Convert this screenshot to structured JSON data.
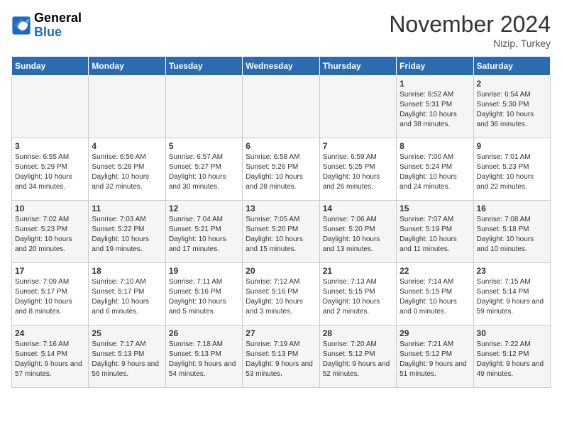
{
  "logo": {
    "line1": "General",
    "line2": "Blue"
  },
  "header": {
    "month": "November 2024",
    "location": "Nizip, Turkey"
  },
  "weekdays": [
    "Sunday",
    "Monday",
    "Tuesday",
    "Wednesday",
    "Thursday",
    "Friday",
    "Saturday"
  ],
  "weeks": [
    [
      {
        "day": "",
        "info": ""
      },
      {
        "day": "",
        "info": ""
      },
      {
        "day": "",
        "info": ""
      },
      {
        "day": "",
        "info": ""
      },
      {
        "day": "",
        "info": ""
      },
      {
        "day": "1",
        "info": "Sunrise: 6:52 AM\nSunset: 5:31 PM\nDaylight: 10 hours and 38 minutes."
      },
      {
        "day": "2",
        "info": "Sunrise: 6:54 AM\nSunset: 5:30 PM\nDaylight: 10 hours and 36 minutes."
      }
    ],
    [
      {
        "day": "3",
        "info": "Sunrise: 6:55 AM\nSunset: 5:29 PM\nDaylight: 10 hours and 34 minutes."
      },
      {
        "day": "4",
        "info": "Sunrise: 6:56 AM\nSunset: 5:28 PM\nDaylight: 10 hours and 32 minutes."
      },
      {
        "day": "5",
        "info": "Sunrise: 6:57 AM\nSunset: 5:27 PM\nDaylight: 10 hours and 30 minutes."
      },
      {
        "day": "6",
        "info": "Sunrise: 6:58 AM\nSunset: 5:26 PM\nDaylight: 10 hours and 28 minutes."
      },
      {
        "day": "7",
        "info": "Sunrise: 6:59 AM\nSunset: 5:25 PM\nDaylight: 10 hours and 26 minutes."
      },
      {
        "day": "8",
        "info": "Sunrise: 7:00 AM\nSunset: 5:24 PM\nDaylight: 10 hours and 24 minutes."
      },
      {
        "day": "9",
        "info": "Sunrise: 7:01 AM\nSunset: 5:23 PM\nDaylight: 10 hours and 22 minutes."
      }
    ],
    [
      {
        "day": "10",
        "info": "Sunrise: 7:02 AM\nSunset: 5:23 PM\nDaylight: 10 hours and 20 minutes."
      },
      {
        "day": "11",
        "info": "Sunrise: 7:03 AM\nSunset: 5:22 PM\nDaylight: 10 hours and 19 minutes."
      },
      {
        "day": "12",
        "info": "Sunrise: 7:04 AM\nSunset: 5:21 PM\nDaylight: 10 hours and 17 minutes."
      },
      {
        "day": "13",
        "info": "Sunrise: 7:05 AM\nSunset: 5:20 PM\nDaylight: 10 hours and 15 minutes."
      },
      {
        "day": "14",
        "info": "Sunrise: 7:06 AM\nSunset: 5:20 PM\nDaylight: 10 hours and 13 minutes."
      },
      {
        "day": "15",
        "info": "Sunrise: 7:07 AM\nSunset: 5:19 PM\nDaylight: 10 hours and 11 minutes."
      },
      {
        "day": "16",
        "info": "Sunrise: 7:08 AM\nSunset: 5:18 PM\nDaylight: 10 hours and 10 minutes."
      }
    ],
    [
      {
        "day": "17",
        "info": "Sunrise: 7:09 AM\nSunset: 5:17 PM\nDaylight: 10 hours and 8 minutes."
      },
      {
        "day": "18",
        "info": "Sunrise: 7:10 AM\nSunset: 5:17 PM\nDaylight: 10 hours and 6 minutes."
      },
      {
        "day": "19",
        "info": "Sunrise: 7:11 AM\nSunset: 5:16 PM\nDaylight: 10 hours and 5 minutes."
      },
      {
        "day": "20",
        "info": "Sunrise: 7:12 AM\nSunset: 5:16 PM\nDaylight: 10 hours and 3 minutes."
      },
      {
        "day": "21",
        "info": "Sunrise: 7:13 AM\nSunset: 5:15 PM\nDaylight: 10 hours and 2 minutes."
      },
      {
        "day": "22",
        "info": "Sunrise: 7:14 AM\nSunset: 5:15 PM\nDaylight: 10 hours and 0 minutes."
      },
      {
        "day": "23",
        "info": "Sunrise: 7:15 AM\nSunset: 5:14 PM\nDaylight: 9 hours and 59 minutes."
      }
    ],
    [
      {
        "day": "24",
        "info": "Sunrise: 7:16 AM\nSunset: 5:14 PM\nDaylight: 9 hours and 57 minutes."
      },
      {
        "day": "25",
        "info": "Sunrise: 7:17 AM\nSunset: 5:13 PM\nDaylight: 9 hours and 56 minutes."
      },
      {
        "day": "26",
        "info": "Sunrise: 7:18 AM\nSunset: 5:13 PM\nDaylight: 9 hours and 54 minutes."
      },
      {
        "day": "27",
        "info": "Sunrise: 7:19 AM\nSunset: 5:13 PM\nDaylight: 9 hours and 53 minutes."
      },
      {
        "day": "28",
        "info": "Sunrise: 7:20 AM\nSunset: 5:12 PM\nDaylight: 9 hours and 52 minutes."
      },
      {
        "day": "29",
        "info": "Sunrise: 7:21 AM\nSunset: 5:12 PM\nDaylight: 9 hours and 51 minutes."
      },
      {
        "day": "30",
        "info": "Sunrise: 7:22 AM\nSunset: 5:12 PM\nDaylight: 9 hours and 49 minutes."
      }
    ]
  ]
}
